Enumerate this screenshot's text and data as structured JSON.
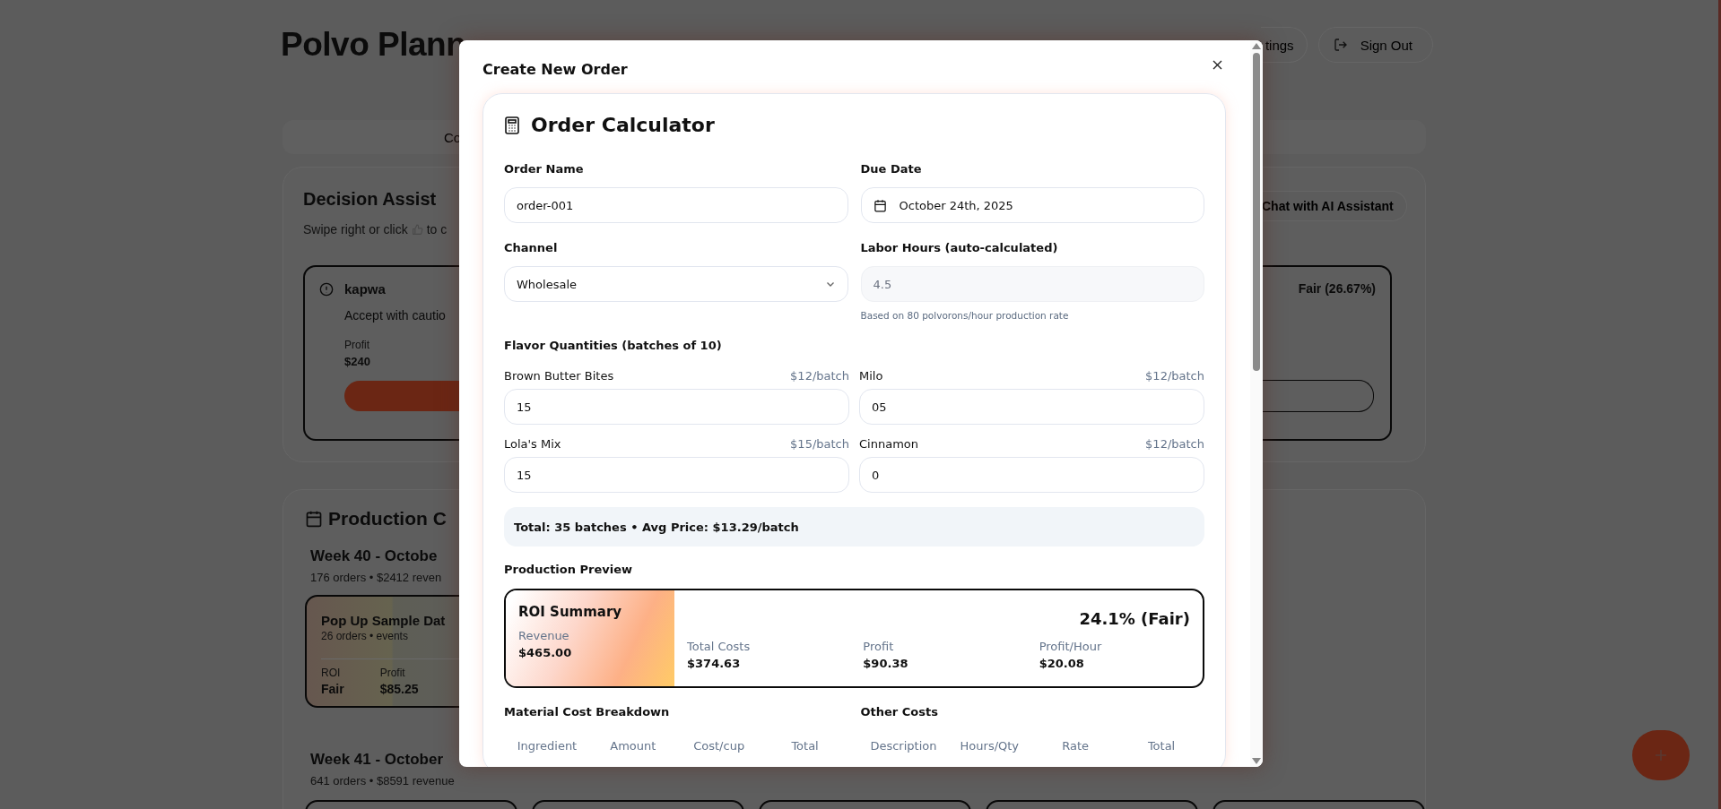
{
  "background_page": {
    "app_title": "Polvo Plann",
    "header_buttons": [
      {
        "label": "tings",
        "kind": "plain"
      },
      {
        "label": "Sign Out",
        "kind": "sign_out"
      }
    ],
    "tab_bar": {
      "visible_label": "Co"
    },
    "decision_assistant": {
      "title": "Decision Assist",
      "subtitle_start": "Swipe right or click",
      "subtitle_end": "to c",
      "chat_button": "Chat with AI Assistant",
      "suggestion": {
        "name": "kapwa",
        "advice": "Accept with cautio",
        "profit_label": "Profit",
        "profit": "$240",
        "rating": "Fair (26.67%)"
      }
    },
    "production_calendar": {
      "title": "Production C",
      "weeks": [
        {
          "title": "Week 40 - Octobe",
          "summary": "176 orders • $2412 reven",
          "events": [
            {
              "name": "Pop Up Sample Dat",
              "meta": "26 orders • events",
              "roi_label": "ROI",
              "roi": "Fair",
              "profit_label": "Profit",
              "profit": "$85.25"
            }
          ]
        },
        {
          "title": "Week 41 - October",
          "summary": "641 orders • $8591 revenue"
        }
      ]
    }
  },
  "modal": {
    "title": "Create New Order",
    "calculator": {
      "title": "Order Calculator",
      "fields": [
        {
          "label": "Order Name",
          "kind": "text",
          "value": "order-001",
          "disabled": false
        },
        {
          "label": "Due Date",
          "kind": "date",
          "value": "October 24th, 2025",
          "disabled": false
        },
        {
          "label": "Channel",
          "kind": "select",
          "value": "Wholesale",
          "disabled": false
        },
        {
          "label": "Labor Hours (auto-calculated)",
          "kind": "text",
          "value": "4.5",
          "disabled": true,
          "hint": "Based on 80 polvorons/hour production rate"
        }
      ],
      "flavors_title": "Flavor Quantities (batches of 10)",
      "flavors": [
        {
          "name": "Brown Butter Bites",
          "price": "$12/batch",
          "value": "15"
        },
        {
          "name": "Milo",
          "price": "$12/batch",
          "value": "05"
        },
        {
          "name": "Lola's Mix",
          "price": "$15/batch",
          "value": "15"
        },
        {
          "name": "Cinnamon",
          "price": "$12/batch",
          "value": "0"
        }
      ],
      "total": "Total: 35 batches • Avg Price: $13.29/batch",
      "preview_title": "Production Preview",
      "roi": {
        "title": "ROI Summary",
        "score": "24.1% (Fair)",
        "metrics": [
          {
            "label": "Revenue",
            "value": "$465.00"
          },
          {
            "label": "Total Costs",
            "value": "$374.63"
          },
          {
            "label": "Profit",
            "value": "$90.38"
          },
          {
            "label": "Profit/Hour",
            "value": "$20.08"
          }
        ]
      },
      "tables": [
        {
          "title": "Material Cost Breakdown",
          "columns": [
            "Ingredient",
            "Amount",
            "Cost/cup",
            "Total"
          ]
        },
        {
          "title": "Other Costs",
          "columns": [
            "Description",
            "Hours/Qty",
            "Rate",
            "Total"
          ]
        }
      ]
    }
  }
}
